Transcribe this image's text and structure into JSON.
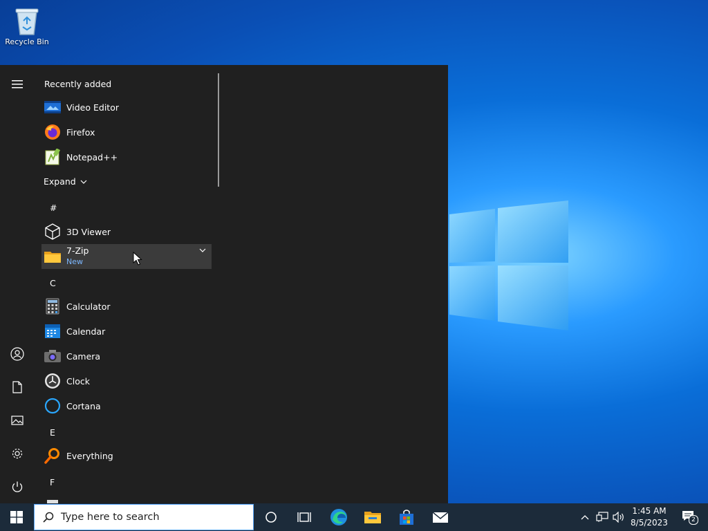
{
  "desktop": {
    "recycle_bin_label": "Recycle Bin"
  },
  "start_menu": {
    "recently_added_header": "Recently added",
    "recent": [
      {
        "label": "Video Editor",
        "icon": "video-editor-icon"
      },
      {
        "label": "Firefox",
        "icon": "firefox-icon"
      },
      {
        "label": "Notepad++",
        "icon": "notepad-plus-plus-icon"
      }
    ],
    "expand_label": "Expand",
    "groups": {
      "hash": "#",
      "c": "C",
      "e": "E",
      "f": "F"
    },
    "apps": {
      "viewer_3d": "3D Viewer",
      "sevenzip": "7-Zip",
      "sevenzip_tag": "New",
      "calculator": "Calculator",
      "calendar": "Calendar",
      "camera": "Camera",
      "clock": "Clock",
      "cortana": "Cortana",
      "everything": "Everything"
    }
  },
  "taskbar": {
    "search_placeholder": "Type here to search",
    "time": "1:45 AM",
    "date": "8/5/2023",
    "notification_count": "2"
  },
  "colors": {
    "accent": "#0078d7",
    "start_bg": "#202020",
    "taskbar_bg": "#1c2b3a",
    "new_tag": "#7db8ff"
  }
}
